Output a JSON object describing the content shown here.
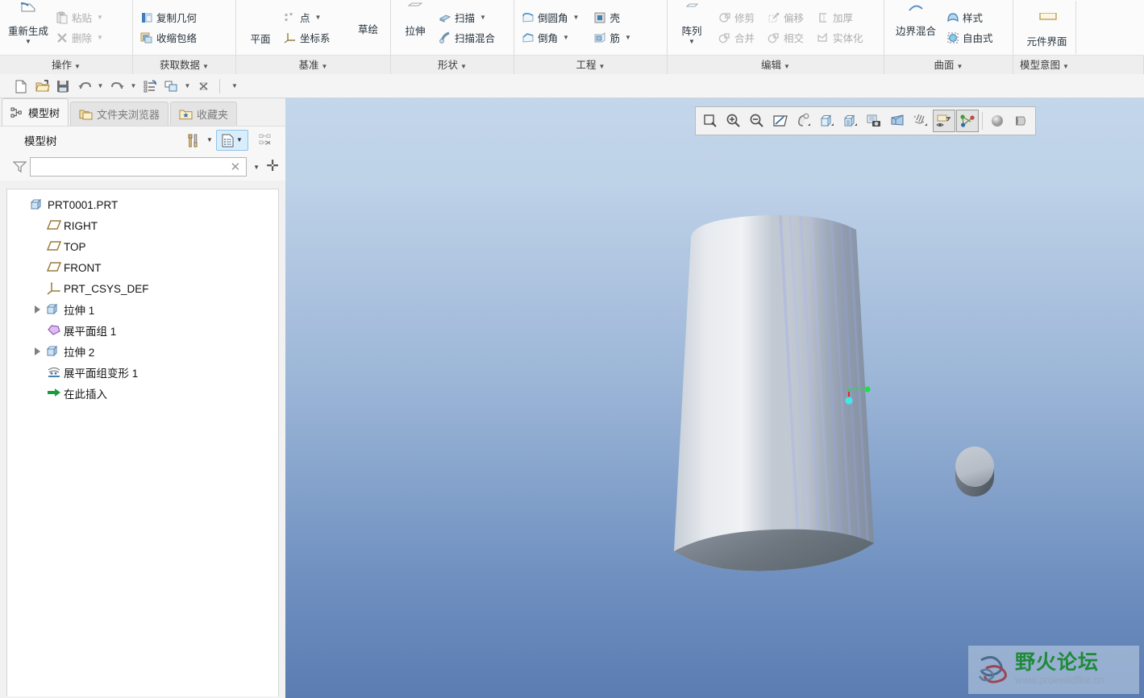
{
  "ribbon": {
    "groups": [
      {
        "name": "operations",
        "footer": "操作",
        "big": [
          {
            "label": "重新生成",
            "icon": "regenerate-icon",
            "dropdown": true,
            "disabled": false
          }
        ],
        "small": [
          {
            "label": "粘贴",
            "icon": "paste-icon",
            "dropdown": true,
            "disabled": true
          },
          {
            "label": "删除",
            "icon": "delete-x-icon",
            "dropdown": true,
            "disabled": true
          }
        ]
      },
      {
        "name": "get-data",
        "footer": "获取数据",
        "big": [],
        "small": [
          {
            "label": "复制几何",
            "icon": "copy-geometry-icon",
            "dropdown": false,
            "disabled": false
          },
          {
            "label": "收缩包络",
            "icon": "shrinkwrap-icon",
            "dropdown": false,
            "disabled": false
          }
        ]
      },
      {
        "name": "datum",
        "footer": "基准",
        "big": [
          {
            "label": "平面",
            "icon": "datum-plane-icon",
            "dropdown": false,
            "disabled": false
          },
          {
            "label": "草绘",
            "icon": "sketch-icon",
            "dropdown": false,
            "disabled": false
          }
        ],
        "small": [
          {
            "label": "点",
            "icon": "datum-point-icon",
            "dropdown": true,
            "disabled": false
          },
          {
            "label": "坐标系",
            "icon": "csys-icon",
            "dropdown": false,
            "disabled": false
          }
        ]
      },
      {
        "name": "shapes",
        "footer": "形状",
        "big": [
          {
            "label": "拉伸",
            "icon": "extrude-icon",
            "dropdown": false,
            "disabled": false
          }
        ],
        "small": [
          {
            "label": "扫描",
            "icon": "sweep-icon",
            "dropdown": true,
            "disabled": false
          },
          {
            "label": "扫描混合",
            "icon": "swept-blend-icon",
            "dropdown": false,
            "disabled": false
          }
        ]
      },
      {
        "name": "engineering",
        "footer": "工程",
        "big": [],
        "small": [
          {
            "label": "倒圆角",
            "icon": "round-icon",
            "dropdown": true,
            "disabled": false
          },
          {
            "label": "壳",
            "icon": "shell-icon",
            "dropdown": false,
            "disabled": false
          },
          {
            "label": "倒角",
            "icon": "chamfer-icon",
            "dropdown": true,
            "disabled": false
          },
          {
            "label": "筋",
            "icon": "rib-icon",
            "dropdown": true,
            "disabled": false
          }
        ]
      },
      {
        "name": "editing",
        "footer": "编辑",
        "big": [
          {
            "label": "阵列",
            "icon": "pattern-icon",
            "dropdown": true,
            "disabled": false
          }
        ],
        "small": [
          {
            "label": "修剪",
            "icon": "trim-icon",
            "dropdown": false,
            "disabled": true
          },
          {
            "label": "偏移",
            "icon": "offset-icon",
            "dropdown": false,
            "disabled": true
          },
          {
            "label": "加厚",
            "icon": "thicken-icon",
            "dropdown": false,
            "disabled": true
          },
          {
            "label": "合并",
            "icon": "merge-icon",
            "dropdown": false,
            "disabled": true
          },
          {
            "label": "相交",
            "icon": "intersect-icon",
            "dropdown": false,
            "disabled": true
          },
          {
            "label": "实体化",
            "icon": "solidify-icon",
            "dropdown": false,
            "disabled": true
          }
        ]
      },
      {
        "name": "surfaces",
        "footer": "曲面",
        "big": [
          {
            "label": "边界混合",
            "icon": "boundary-blend-icon",
            "dropdown": false,
            "disabled": false
          }
        ],
        "small": [
          {
            "label": "样式",
            "icon": "style-icon",
            "dropdown": false,
            "disabled": false
          },
          {
            "label": "自由式",
            "icon": "freestyle-icon",
            "dropdown": false,
            "disabled": false
          }
        ]
      },
      {
        "name": "model-intent",
        "footer": "模型意图",
        "big": [
          {
            "label": "元件界面",
            "icon": "component-interface-icon",
            "dropdown": false,
            "disabled": false
          }
        ],
        "small": []
      }
    ]
  },
  "quick_access": {
    "buttons": [
      {
        "name": "new-file-button",
        "icon": "new-file-icon"
      },
      {
        "name": "open-file-button",
        "icon": "open-folder-icon"
      },
      {
        "name": "save-button",
        "icon": "save-disk-icon"
      },
      {
        "name": "undo-button",
        "icon": "undo-arrow-icon",
        "dropdown": true
      },
      {
        "name": "redo-button",
        "icon": "redo-arrow-icon",
        "dropdown": true
      },
      {
        "name": "regenerate-button",
        "icon": "regenerate-list-icon"
      },
      {
        "name": "window-button",
        "icon": "windows-stack-icon",
        "dropdown": true
      },
      {
        "name": "close-window-button",
        "icon": "close-x-icon"
      }
    ],
    "overflow_caret": "▼"
  },
  "left_panel": {
    "tabs": [
      {
        "label": "模型树",
        "icon": "model-tree-icon",
        "active": true
      },
      {
        "label": "文件夹浏览器",
        "icon": "folder-browser-icon",
        "active": false
      },
      {
        "label": "收藏夹",
        "icon": "favorites-folder-icon",
        "active": false
      }
    ],
    "header": {
      "title": "模型树",
      "tools_icon": "tools-hammer-icon",
      "settings_icon": "display-list-icon",
      "tree_filter_icon": "tree-structure-off-icon"
    },
    "filter": {
      "icon": "funnel-filter-icon",
      "value": "",
      "placeholder": "",
      "clear_icon": "clear-x-icon",
      "dropdown_icon": "chevron-down-icon",
      "add_icon": "plus-icon"
    },
    "tree": [
      {
        "label": "PRT0001.PRT",
        "icon": "part-cube-icon",
        "depth": 0,
        "arrow": "none"
      },
      {
        "label": "RIGHT",
        "icon": "datum-plane-icon",
        "depth": 1,
        "arrow": "none"
      },
      {
        "label": "TOP",
        "icon": "datum-plane-icon",
        "depth": 1,
        "arrow": "none"
      },
      {
        "label": "FRONT",
        "icon": "datum-plane-icon",
        "depth": 1,
        "arrow": "none"
      },
      {
        "label": "PRT_CSYS_DEF",
        "icon": "csys-icon",
        "depth": 1,
        "arrow": "none"
      },
      {
        "label": "拉伸 1",
        "icon": "extrude-feature-icon",
        "depth": 1,
        "arrow": "collapsed"
      },
      {
        "label": "展平面组 1",
        "icon": "flatten-quilt-icon",
        "depth": 1,
        "arrow": "none"
      },
      {
        "label": "拉伸 2",
        "icon": "extrude-feature-icon",
        "depth": 1,
        "arrow": "collapsed"
      },
      {
        "label": "展平面组变形 1",
        "icon": "flatten-deform-icon",
        "depth": 1,
        "arrow": "none"
      },
      {
        "label": "在此插入",
        "icon": "insert-here-arrow-icon",
        "depth": 1,
        "arrow": "none"
      }
    ]
  },
  "viewport": {
    "graphics_toolbar": [
      {
        "name": "zoom-to-fit-button",
        "icon": "zoom-box-icon"
      },
      {
        "name": "zoom-in-button",
        "icon": "zoom-in-icon"
      },
      {
        "name": "zoom-out-button",
        "icon": "zoom-out-icon"
      },
      {
        "name": "refit-button",
        "icon": "refit-diagonal-icon"
      },
      {
        "name": "reorient-button",
        "icon": "reorient-icon",
        "dropdown": true
      },
      {
        "name": "saved-views-button",
        "icon": "view-cube-icon",
        "dropdown": true
      },
      {
        "name": "display-style-button",
        "icon": "display-style-icon",
        "dropdown": true
      },
      {
        "name": "view-manager-button",
        "icon": "view-manager-camera-icon"
      },
      {
        "name": "perspective-button",
        "icon": "perspective-cube-icon"
      },
      {
        "name": "datum-display-button",
        "icon": "datum-display-icon",
        "dropdown": true
      },
      {
        "name": "annotation-display-button",
        "icon": "annotation-eye-icon",
        "framed": true
      },
      {
        "name": "spin-center-button",
        "icon": "spin-center-icon",
        "framed": true
      },
      {
        "name": "appearance-button",
        "icon": "appearance-sphere-icon"
      },
      {
        "name": "scene-button",
        "icon": "scene-light-icon"
      }
    ],
    "model": {
      "main_solid": "cylinder-extrude",
      "secondary_solid": "small-disc",
      "handle": "drag-handle"
    }
  },
  "watermark": {
    "title": "野火论坛",
    "url": "www.proewildfire.cn",
    "logo_icon": "proewildfire-logo-icon",
    "title_color": "#1f8a3a"
  }
}
